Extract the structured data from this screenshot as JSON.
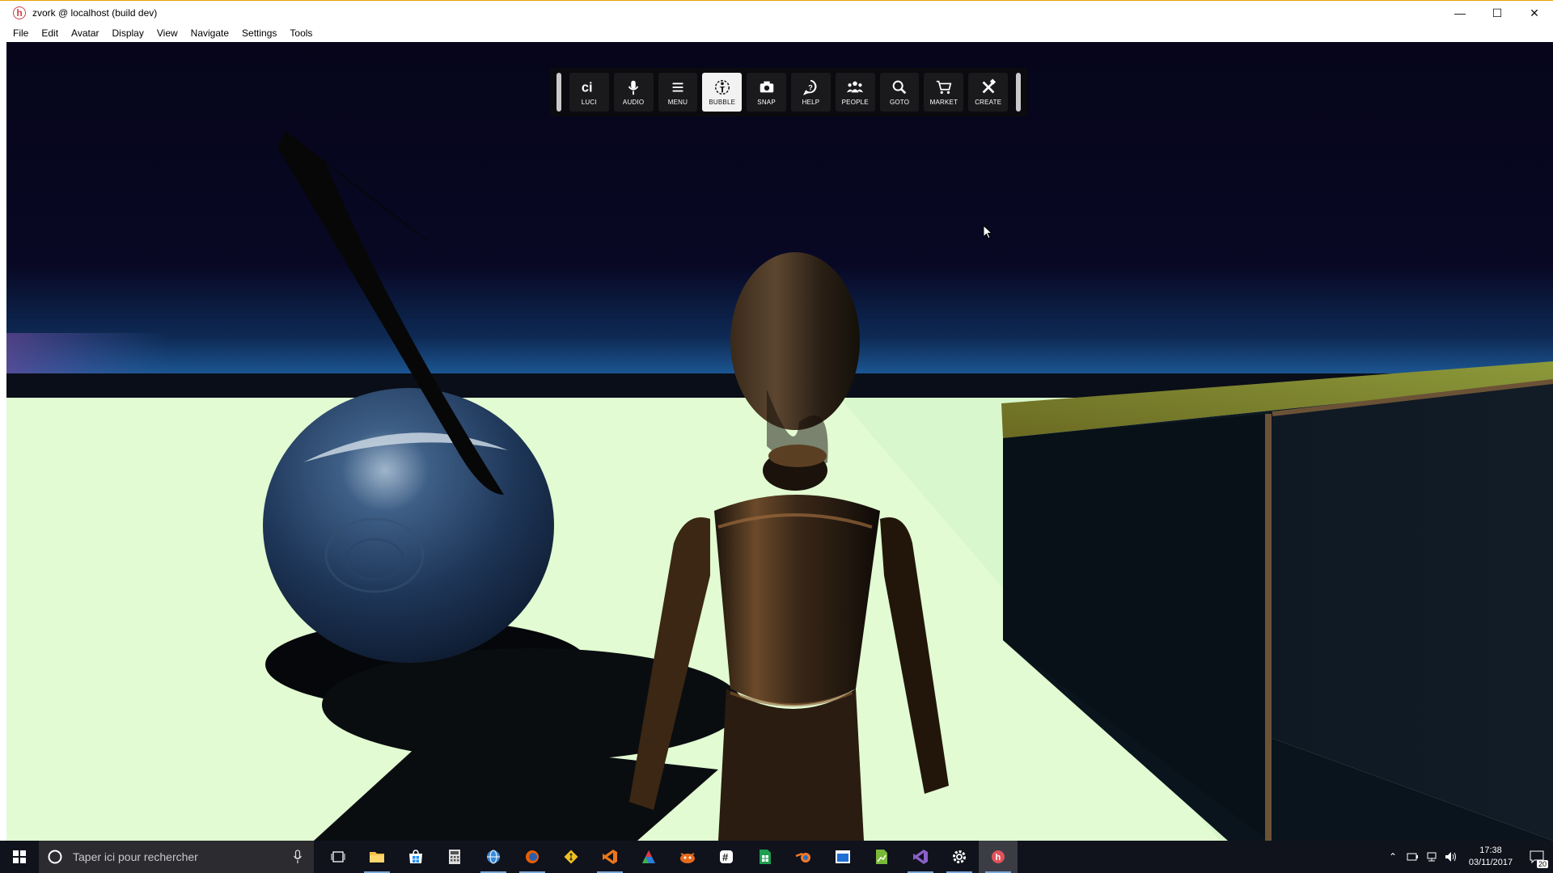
{
  "window": {
    "title": "zvork @ localhost (build dev)",
    "icon": "hifi-logo-icon",
    "controls": [
      "minimize-icon",
      "maximize-icon",
      "close-icon"
    ]
  },
  "menubar": {
    "items": [
      "File",
      "Edit",
      "Avatar",
      "Display",
      "View",
      "Navigate",
      "Settings",
      "Tools"
    ]
  },
  "toolbar": {
    "buttons": [
      {
        "label": "LUCI",
        "icon": "luci-icon",
        "active": false
      },
      {
        "label": "AUDIO",
        "icon": "microphone-icon",
        "active": false
      },
      {
        "label": "MENU",
        "icon": "hamburger-icon",
        "active": false
      },
      {
        "label": "BUBBLE",
        "icon": "bubble-icon",
        "active": true
      },
      {
        "label": "SNAP",
        "icon": "camera-icon",
        "active": false
      },
      {
        "label": "HELP",
        "icon": "help-icon",
        "active": false
      },
      {
        "label": "PEOPLE",
        "icon": "people-icon",
        "active": false
      },
      {
        "label": "GOTO",
        "icon": "magnifier-icon",
        "active": false
      },
      {
        "label": "MARKET",
        "icon": "cart-icon",
        "active": false
      },
      {
        "label": "CREATE",
        "icon": "create-tools-icon",
        "active": false
      }
    ]
  },
  "taskbar": {
    "search_placeholder": "Taper ici pour rechercher",
    "apps": [
      "task-view-icon",
      "file-explorer-icon",
      "store-icon",
      "calculator-icon",
      "browser-icon",
      "firefox-icon",
      "git-icon",
      "visual-studio-icon",
      "color-icon",
      "daemon-icon",
      "slack-icon",
      "spreadsheet-icon",
      "blender-icon",
      "window-icon",
      "chart-icon",
      "vs-purple-icon",
      "settings-icon",
      "hifi-app-icon"
    ],
    "clock": {
      "time": "17:38",
      "date": "03/11/2017"
    },
    "notifications": "20"
  },
  "colors": {
    "accent": "#e8a200",
    "toolbar_bg": "#0c0c0e",
    "button_active": "#f2f2f2",
    "sky_top": "#07061a",
    "floor": "#e2fbd2",
    "taskbar": "#10121c"
  }
}
